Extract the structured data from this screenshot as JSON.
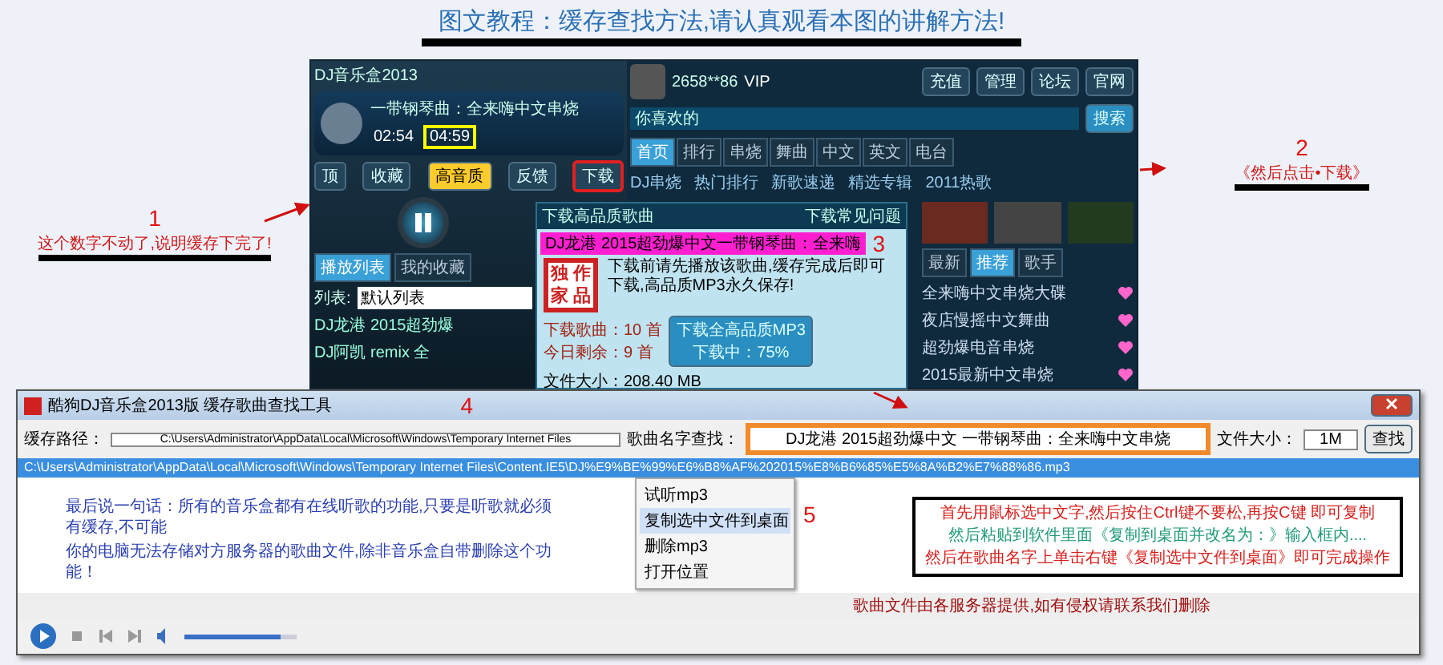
{
  "title": "图文教程：缓存查找方法,请认真观看本图的讲解方法!",
  "annotations": [
    {
      "number": "1",
      "text": "这个数字不动了,说明缓存下完了!"
    },
    {
      "number": "2",
      "text": "《然后点击•下载》"
    }
  ],
  "player": {
    "title": "DJ音乐盒2013",
    "song": "一带钢琴曲：全来嗨中文串烧",
    "elapsed": "02:54",
    "duration": "04:59",
    "buttons": [
      {
        "label": "顶",
        "highlighted": false
      },
      {
        "label": "收藏",
        "highlighted": false
      },
      {
        "label": "反馈",
        "highlighted": false
      },
      {
        "label": "下载",
        "highlighted": true
      }
    ],
    "quality": "高音质",
    "tabs": [
      {
        "label": "播放列表",
        "selected": true
      },
      {
        "label": "我的收藏",
        "selected": false
      }
    ],
    "list_label": "列表:",
    "list_value": "默认列表",
    "tracks": [
      "DJ龙港 2015超劲爆",
      "DJ阿凯 remix 全"
    ]
  },
  "portal": {
    "user": "2658**86",
    "vip": "VIP",
    "top_buttons": [
      "充值",
      "管理",
      "论坛",
      "官网"
    ],
    "search_value": "你喜欢的",
    "search_button": "搜索",
    "tabs": [
      {
        "label": "首页",
        "selected": true
      },
      {
        "label": "排行",
        "selected": false
      },
      {
        "label": "串烧",
        "selected": false
      },
      {
        "label": "舞曲",
        "selected": false
      },
      {
        "label": "中文",
        "selected": false
      },
      {
        "label": "英文",
        "selected": false
      },
      {
        "label": "电台",
        "selected": false
      }
    ],
    "links": [
      "DJ串烧",
      "热门排行",
      "新歌速递",
      "精选专辑",
      "2011热歌"
    ],
    "sub_tabs": [
      {
        "label": "最新",
        "selected": false
      },
      {
        "label": "推荐",
        "selected": true
      },
      {
        "label": "歌手",
        "selected": false
      }
    ],
    "songs": [
      "全来嗨中文串烧大碟",
      "夜店慢摇中文舞曲",
      "超劲爆电音串烧",
      "2015最新中文串烧"
    ]
  },
  "popup": {
    "title": "下载高品质歌曲",
    "help": "下载常见问题",
    "file": "DJ龙港 2015超劲爆中文一带钢琴曲：全来嗨",
    "number": "3",
    "stamp": [
      "独",
      "作",
      "家",
      "品"
    ],
    "description": "下载前请先播放该歌曲,缓存完成后即可下载,高品质MP3永久保存!",
    "stats": [
      "下载歌曲：10 首",
      "今日剩余：9 首"
    ],
    "download_button": "下载全高品质MP3",
    "progress": "下载中：75%",
    "size": "文件大小：208.40 MB"
  },
  "tool": {
    "title": "酷狗DJ音乐盒2013版 缓存歌曲查找工具",
    "path_label": "缓存路径：",
    "path_value": "C:\\Users\\Administrator\\AppData\\Local\\Microsoft\\Windows\\Temporary Internet Files",
    "name_label": "歌曲名字查找：",
    "name_value": "DJ龙港 2015超劲爆中文 一带钢琴曲：全来嗨中文串烧",
    "size_label": "文件大小：",
    "size_value": "1M",
    "find_button": "查找",
    "number": "4",
    "row": "C:\\Users\\Administrator\\AppData\\Local\\Microsoft\\Windows\\Temporary Internet Files\\Content.IE5\\DJ%E9%BE%99%E6%B8%AF%202015%E8%B6%85%E5%8A%B2%E7%88%86.mp3",
    "menu": [
      {
        "label": "试听mp3",
        "selected": false
      },
      {
        "label": "复制选中文件到桌面",
        "selected": true
      },
      {
        "label": "删除mp3",
        "selected": false
      },
      {
        "label": "打开位置",
        "selected": false
      }
    ],
    "menu_number": "5",
    "notice": [
      "最后说一句话：所有的音乐盒都有在线听歌的功能,只要是听歌就必须有缓存,不可能",
      "你的电脑无法存储对方服务器的歌曲文件,除非音乐盒自带删除这个功能！"
    ],
    "instructions": [
      {
        "text": "首先用鼠标选中文字,然后按住Ctrl键不要松,再按C键 即可复制",
        "color": "#d8201c"
      },
      {
        "text": "然后粘贴到软件里面《复制到桌面并改名为：》输入框内....",
        "color": "#1f9a7a"
      },
      {
        "text": "然后在歌曲名字上单击右键《复制选中文件到桌面》即可完成操作",
        "color": "#d8201c"
      }
    ],
    "status": "歌曲文件由各服务器提供,如有侵权请联系我们删除",
    "volume": {
      "level": 0.85
    }
  }
}
